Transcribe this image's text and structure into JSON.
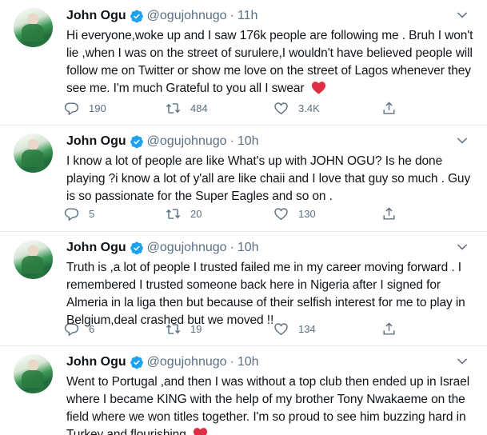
{
  "author": {
    "name": "John Ogu",
    "handle": "@ogujohnugo"
  },
  "tweets": [
    {
      "time": "11h",
      "text": "Hi everyone,woke up and I saw 176k people are following me . Bruh I won't lie ,when I was on the street of surulere,I wouldn't have believed people will follow me on Twitter or show me love on the street of Lagos whenever they see me. I'm much Grateful to you all I swear",
      "emoji": "red-heart",
      "replies": "190",
      "retweets": "484",
      "likes": "3.4K"
    },
    {
      "time": "10h",
      "text": "I know a lot of people are like What's up with JOHN OGU? Is he done playing ?i know a lot of y'all are like chaii and I love that guy so much . Guy is so passionate for the Super Eagles and so on .",
      "replies": "5",
      "retweets": "20",
      "likes": "130"
    },
    {
      "time": "10h",
      "text": "Truth is ,a lot of people I trusted failed me in my career moving forward . I remembered I trusted someone back here in Nigeria after I signed for Almeria in la liga then but because of their selfish interest for me to play in Belgium,deal crashed but we moved !!",
      "replies": "6",
      "retweets": "19",
      "likes": "134"
    },
    {
      "time": "10h",
      "text": "Went to Portugal ,and then I was without a top club then ended up in Israel where I became KING with the help of my brother Tony Nwakaeme on the field where we won titles together. I'm so proud to see him buzzing hard in Turkey and flourishing",
      "emoji": "red-heart"
    }
  ],
  "separator": "·",
  "colors": {
    "verified": "#1da1f2",
    "secondary_text": "#5b7083",
    "heart_emoji": "#dd2e44",
    "divider": "#e6ecf0"
  },
  "icons": [
    "verified-badge-icon",
    "chevron-down-icon",
    "reply-icon",
    "retweet-icon",
    "like-icon",
    "share-icon",
    "red-heart-emoji"
  ]
}
